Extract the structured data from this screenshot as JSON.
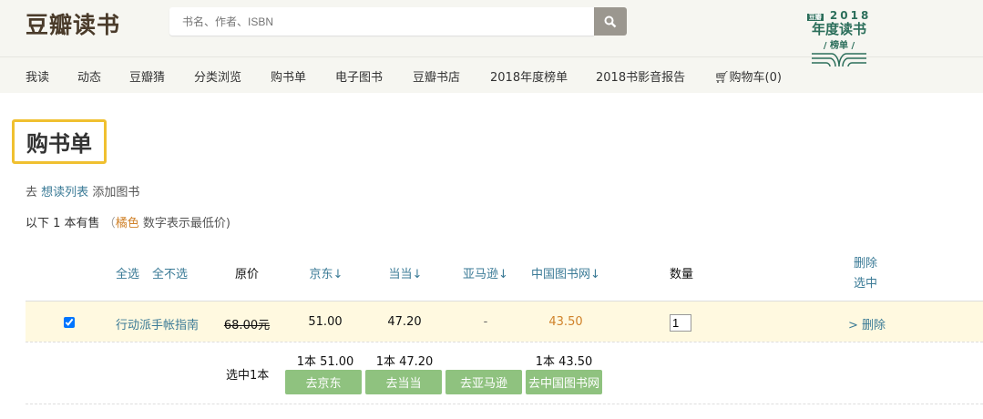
{
  "header": {
    "logo": "豆瓣读书",
    "search_placeholder": "书名、作者、ISBN",
    "badge": {
      "tag": "豆瓣",
      "year": "2018",
      "title": "年度读书",
      "sub": "榜单"
    }
  },
  "nav": [
    "我读",
    "动态",
    "豆瓣猜",
    "分类浏览",
    "购书单",
    "电子图书",
    "豆瓣书店",
    "2018年度榜单",
    "2018书影音报告",
    "购物车(0)"
  ],
  "page": {
    "title": "购书单",
    "hint_prefix": "去",
    "hint_link": "想读列表",
    "hint_suffix": "添加图书",
    "sale_text": "以下 1 本有售",
    "sale_paren_open": "（",
    "sale_orange": "橘色",
    "sale_rest": "数字表示最低价)"
  },
  "table": {
    "headers": {
      "select_all": "全选",
      "select_none": "全不选",
      "original": "原价",
      "jd": "京东↓",
      "dangdang": "当当↓",
      "amazon": "亚马逊↓",
      "china": "中国图书网↓",
      "qty": "数量",
      "delete_line1": "删除",
      "delete_line2": "选中"
    },
    "rows": [
      {
        "checked": true,
        "title": "行动派手帐指南",
        "original": "68.00元",
        "jd": "51.00",
        "dangdang": "47.20",
        "amazon": "-",
        "china": "43.50",
        "qty": "1",
        "delete": "> 删除"
      }
    ],
    "summary": {
      "selected": "选中1本",
      "jd": "1本 51.00",
      "dangdang": "1本 47.20",
      "china": "1本 43.50"
    },
    "buttons": {
      "jd": "去京东",
      "dangdang": "去当当",
      "amazon": "去亚马逊",
      "china": "去中国图书网"
    }
  },
  "colors": {
    "link": "#3a7a96",
    "lowest": "#d0822a",
    "go_button": "#8fc27f",
    "highlight": "#fff9e0"
  }
}
